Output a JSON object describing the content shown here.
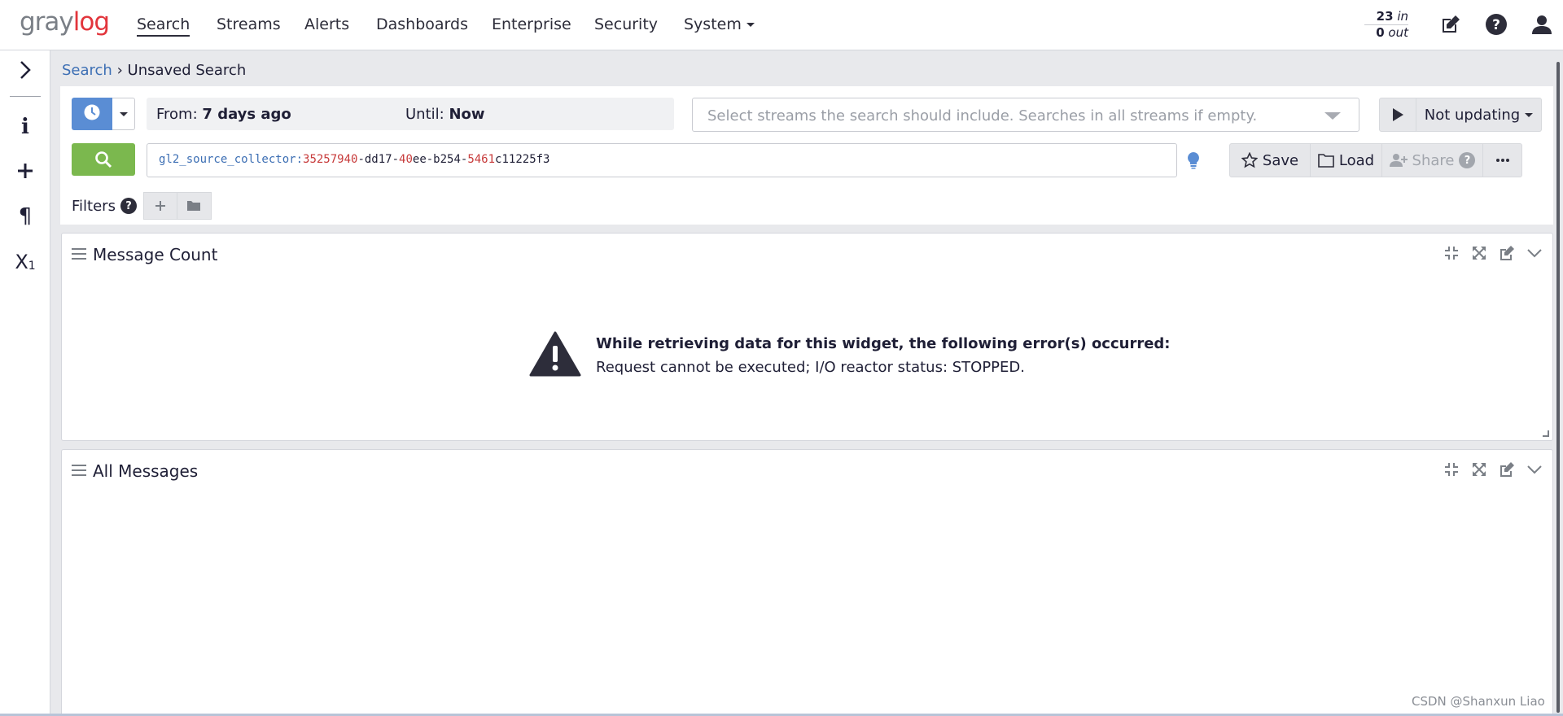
{
  "app": {
    "logo_text": "graylog",
    "logo_prefix": "gray",
    "logo_suffix": "log"
  },
  "nav": {
    "items": [
      {
        "label": "Search",
        "active": true
      },
      {
        "label": "Streams"
      },
      {
        "label": "Alerts"
      },
      {
        "label": "Dashboards"
      },
      {
        "label": "Enterprise"
      },
      {
        "label": "Security"
      },
      {
        "label": "System"
      }
    ],
    "throughput": {
      "in_count": "23",
      "in_label": "in",
      "out_count": "0",
      "out_label": "out"
    },
    "icons": [
      "edit-icon",
      "help-icon",
      "user-icon"
    ]
  },
  "sidebar": {
    "icons": [
      "chevron-right-icon",
      "info-icon",
      "plus-icon",
      "pilcrow-icon",
      "subscript-icon"
    ]
  },
  "breadcrumb": {
    "root": "Search",
    "separator": "›",
    "current": "Unsaved Search"
  },
  "search": {
    "from_label": "From:",
    "from_value": "7 days ago",
    "until_label": "Until:",
    "until_value": "Now",
    "streams_placeholder": "Select streams the search should include. Searches in all streams if empty.",
    "refresh_label": "Not updating",
    "query_key": "gl2_source_collector:",
    "query_parts": [
      "35257940",
      "-dd17-",
      "40",
      "ee-b254-",
      "5461",
      "c11225f3"
    ],
    "actions": {
      "save": "Save",
      "load": "Load",
      "share": "Share"
    },
    "filters_label": "Filters"
  },
  "widgets": [
    {
      "title": "Message Count",
      "error_title": "While retrieving data for this widget, the following error(s) occurred:",
      "error_message": "Request cannot be executed; I/O reactor status: STOPPED."
    },
    {
      "title": "All Messages"
    }
  ],
  "watermark": "CSDN @Shanxun Liao",
  "colors": {
    "primary": "#5a8dd4",
    "success": "#7bb84e",
    "accent": "#e2353c",
    "link": "#3d6fb4"
  }
}
